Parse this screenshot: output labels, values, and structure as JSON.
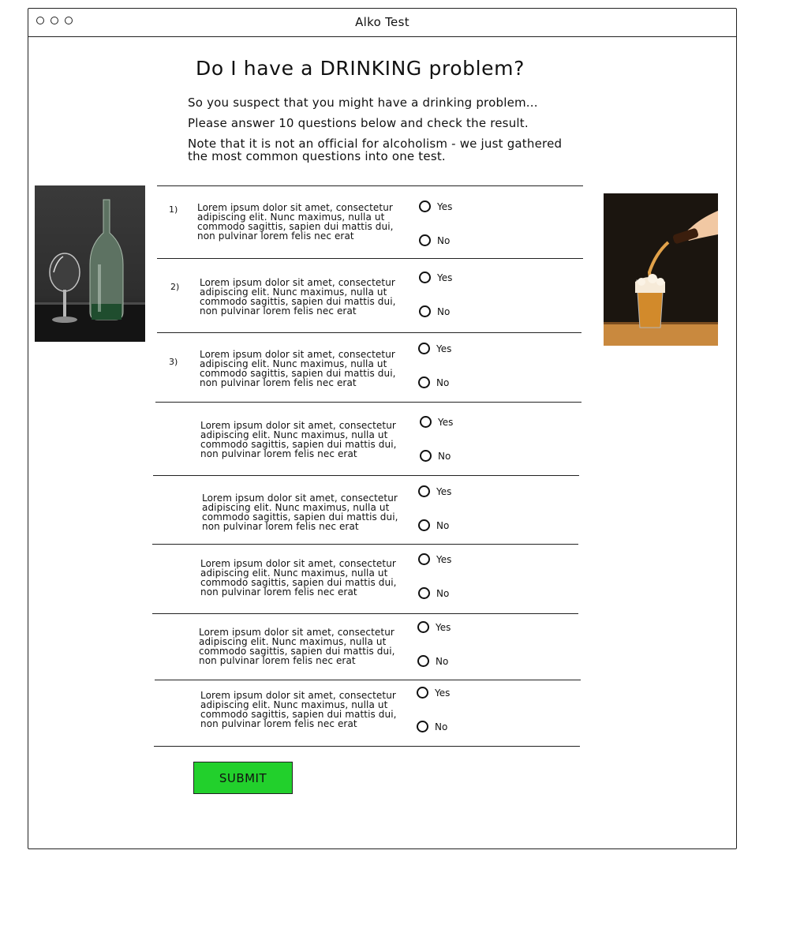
{
  "window": {
    "title": "Alko Test"
  },
  "heading": "Do I have a DRINKING problem?",
  "intro": [
    "So you suspect that you might have a drinking problem...",
    "Please answer 10 questions below and check the result.",
    "Note that it is not an official for alcoholism - we just gathered the most common questions into one test."
  ],
  "questions": [
    {
      "number": "1)",
      "text": "Lorem ipsum dolor sit amet, consectetur adipiscing elit. Nunc maximus, nulla ut commodo sagittis, sapien dui mattis dui, non pulvinar lorem felis nec erat",
      "yes": "Yes",
      "no": "No"
    },
    {
      "number": "2)",
      "text": "Lorem ipsum dolor sit amet, consectetur adipiscing elit. Nunc maximus, nulla ut commodo sagittis, sapien dui mattis dui, non pulvinar lorem felis nec erat",
      "yes": "Yes",
      "no": "No"
    },
    {
      "number": "3)",
      "text": "Lorem ipsum dolor sit amet, consectetur adipiscing elit. Nunc maximus, nulla ut commodo sagittis, sapien dui mattis dui, non pulvinar lorem felis nec erat",
      "yes": "Yes",
      "no": "No"
    },
    {
      "number": "",
      "text": "Lorem ipsum dolor sit amet, consectetur adipiscing elit. Nunc maximus, nulla ut commodo sagittis, sapien dui mattis dui, non pulvinar lorem felis nec erat",
      "yes": "Yes",
      "no": "No"
    },
    {
      "number": "",
      "text": "Lorem ipsum dolor sit amet, consectetur adipiscing elit. Nunc maximus, nulla ut commodo sagittis, sapien dui mattis dui, non pulvinar lorem felis nec erat",
      "yes": "Yes",
      "no": "No"
    },
    {
      "number": "",
      "text": "Lorem ipsum dolor sit amet, consectetur adipiscing elit. Nunc maximus, nulla ut commodo sagittis, sapien dui mattis dui, non pulvinar lorem felis nec erat",
      "yes": "Yes",
      "no": "No"
    },
    {
      "number": "",
      "text": "Lorem ipsum dolor sit amet, consectetur adipiscing elit. Nunc maximus, nulla ut commodo sagittis, sapien dui mattis dui, non pulvinar lorem felis nec erat",
      "yes": "Yes",
      "no": "No"
    },
    {
      "number": "",
      "text": "Lorem ipsum dolor sit amet, consectetur adipiscing elit. Nunc maximus, nulla ut commodo sagittis, sapien dui mattis dui, non pulvinar lorem felis nec erat",
      "yes": "Yes",
      "no": "No"
    }
  ],
  "submit_label": "SUBMIT",
  "images": {
    "left": "wine-glass-and-bottle-photo",
    "right": "beer-pouring-photo"
  },
  "colors": {
    "submit": "#22d02c",
    "ink": "#222222"
  }
}
